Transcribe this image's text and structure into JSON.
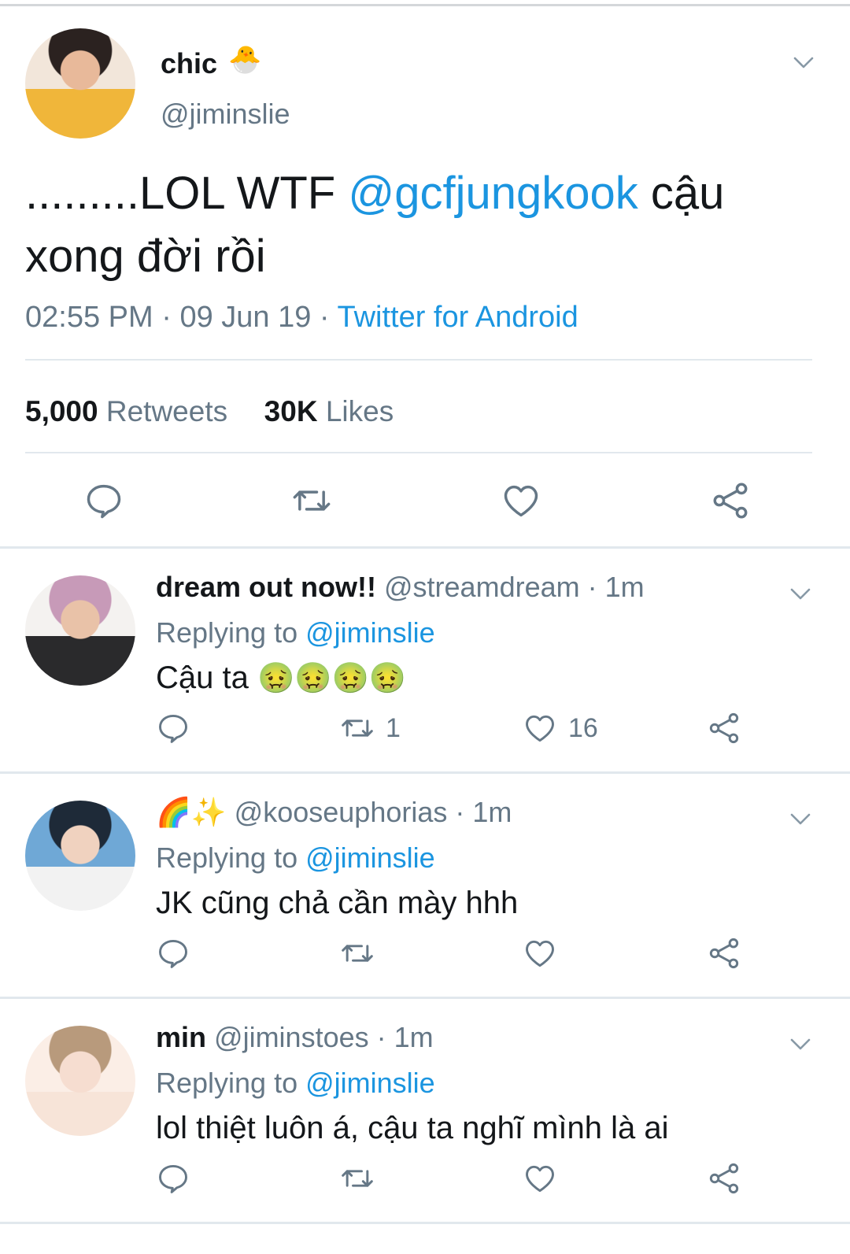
{
  "main_tweet": {
    "display_name": "chic",
    "name_emoji": "🐣",
    "handle": "@jiminslie",
    "text_before": ".........LOL WTF ",
    "mention": "@gcfjungkook",
    "text_after": " cậu xong đời rồi",
    "time": "02:55 PM",
    "date": "09 Jun 19",
    "source": "Twitter for Android",
    "retweets_count": "5,000",
    "retweets_label": "Retweets",
    "likes_count": "30K",
    "likes_label": "Likes"
  },
  "replies": [
    {
      "name": "dream out now!!",
      "handle": "@streamdream",
      "time": "1m",
      "replying_label": "Replying to",
      "replying_to": "@jiminslie",
      "text": "Cậu ta",
      "emojis": "🤢🤢🤢🤢",
      "retweets": "1",
      "likes": "16"
    },
    {
      "name": "🌈✨",
      "handle": "@kooseuphorias",
      "time": "1m",
      "replying_label": "Replying to",
      "replying_to": "@jiminslie",
      "text": "JK cũng chả cần mày hhh",
      "emojis": "",
      "retweets": "",
      "likes": ""
    },
    {
      "name": "min",
      "handle": "@jiminstoes",
      "time": "1m",
      "replying_label": "Replying to",
      "replying_to": "@jiminslie",
      "text": "lol thiệt luôn á, cậu ta nghĩ mình là ai",
      "emojis": "",
      "retweets": "",
      "likes": ""
    }
  ],
  "colors": {
    "link": "#1b95e0",
    "secondary_text": "#657786",
    "primary_text": "#14171a",
    "divider": "#e1e8ed"
  }
}
